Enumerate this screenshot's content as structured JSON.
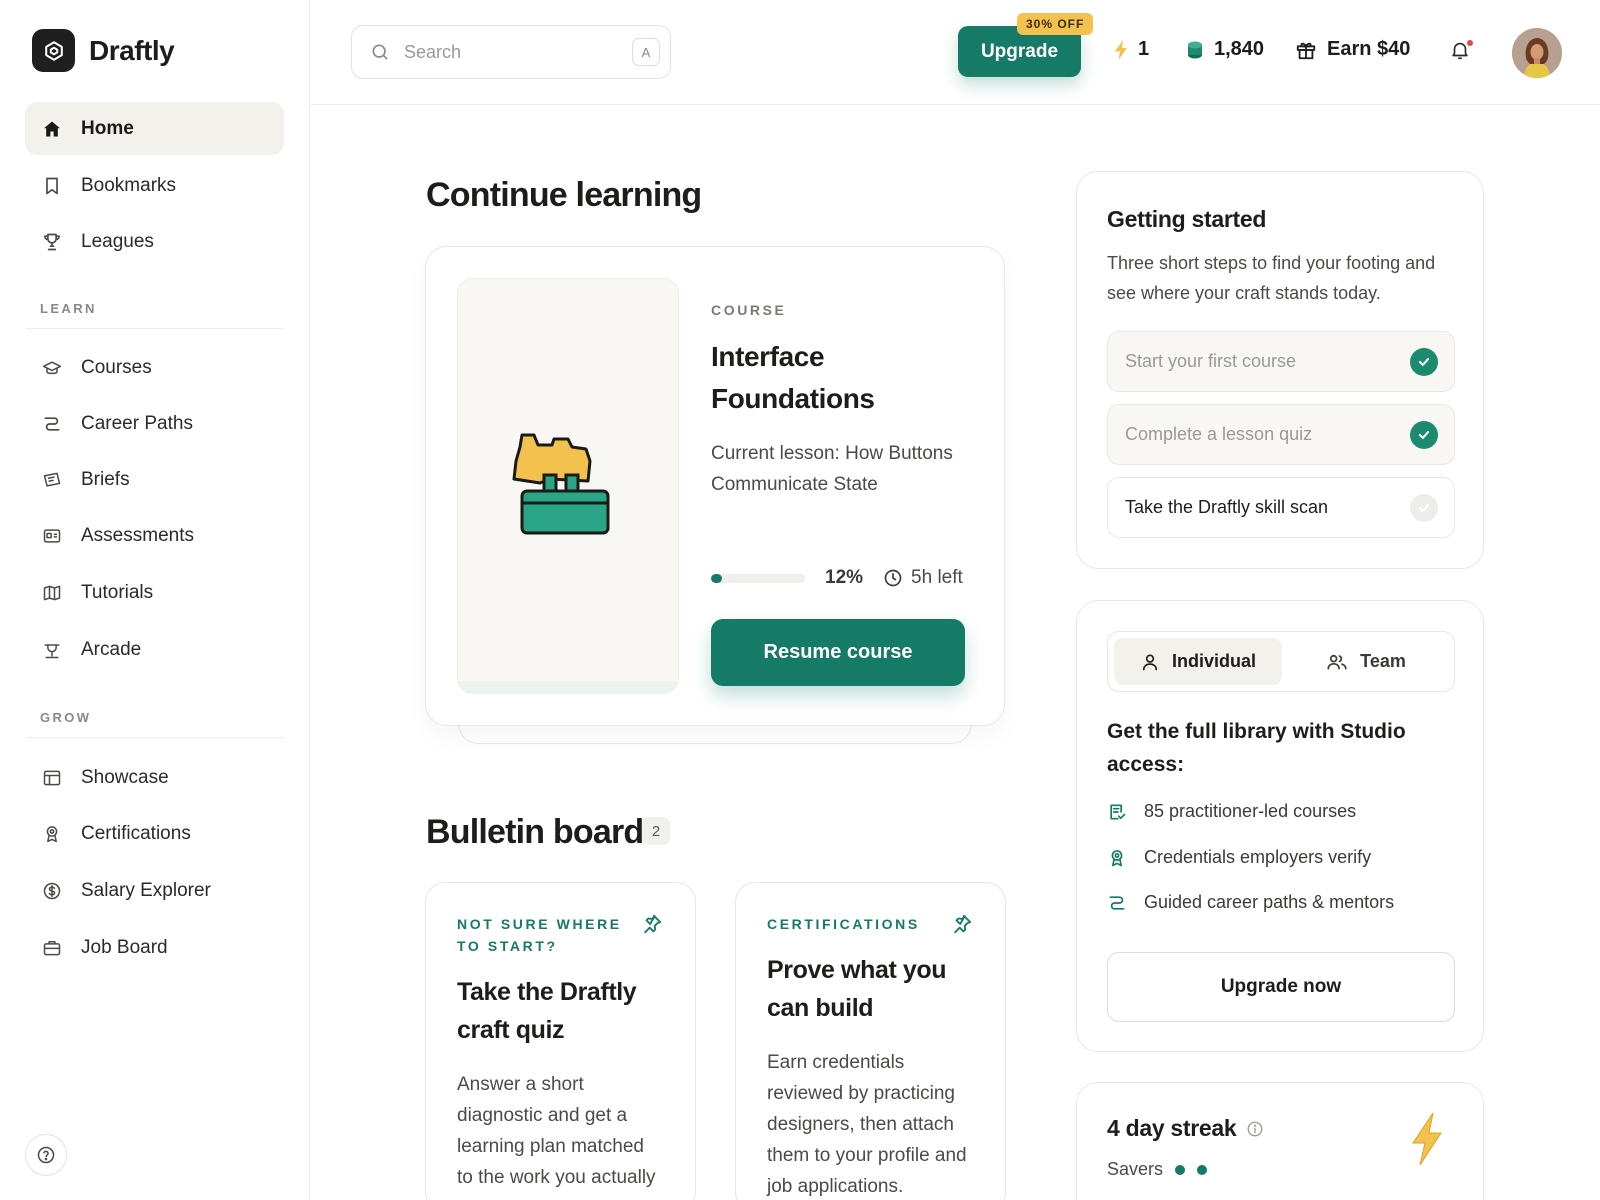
{
  "brand": {
    "name": "Draftly"
  },
  "sidebar": {
    "primary": [
      {
        "label": "Home",
        "icon": "home-icon",
        "active": true
      },
      {
        "label": "Bookmarks",
        "icon": "bookmark-icon"
      },
      {
        "label": "Leagues",
        "icon": "trophy-icon"
      }
    ],
    "learn_label": "LEARN",
    "learn": [
      {
        "label": "Courses",
        "icon": "graduation-cap-icon"
      },
      {
        "label": "Career Paths",
        "icon": "path-icon"
      },
      {
        "label": "Briefs",
        "icon": "brief-icon"
      },
      {
        "label": "Assessments",
        "icon": "id-card-icon"
      },
      {
        "label": "Tutorials",
        "icon": "map-icon"
      },
      {
        "label": "Arcade",
        "icon": "arcade-icon"
      }
    ],
    "grow_label": "GROW",
    "grow": [
      {
        "label": "Showcase",
        "icon": "layout-icon"
      },
      {
        "label": "Certifications",
        "icon": "award-icon"
      },
      {
        "label": "Salary Explorer",
        "icon": "dollar-icon"
      },
      {
        "label": "Job Board",
        "icon": "briefcase-icon"
      }
    ]
  },
  "header": {
    "search_placeholder": "Search",
    "search_shortcut": "A",
    "upgrade_label": "Upgrade",
    "discount_label": "30% OFF",
    "energy": "1",
    "coins": "1,840",
    "earn_label": "Earn $40"
  },
  "main": {
    "continue_title": "Continue learning",
    "course": {
      "eyebrow": "COURSE",
      "title": "Interface Foundations",
      "lesson": "Current lesson: How Buttons Communicate State",
      "progress": 0.12,
      "progress_label": "12%",
      "time_left": "5h left",
      "resume_label": "Resume course"
    },
    "bulletin_title": "Bulletin board",
    "bulletin_count": "2",
    "bulletin": [
      {
        "eyebrow": "NOT SURE WHERE TO START?",
        "title": "Take the Draftly craft quiz",
        "body": "Answer a short diagnostic and get a learning plan matched to the work you actually do day to day."
      },
      {
        "eyebrow": "CERTIFICATIONS",
        "title": "Prove what you can build",
        "body": "Earn credentials reviewed by practicing designers, then attach them to your profile and job applications."
      }
    ]
  },
  "getting_started": {
    "title": "Getting started",
    "subtitle": "Three short steps to find your footing and see where your craft stands today.",
    "steps": [
      {
        "label": "Start your first course",
        "done": true
      },
      {
        "label": "Complete a lesson quiz",
        "done": true
      },
      {
        "label": "Take the Draftly skill scan",
        "done": false
      }
    ]
  },
  "plans": {
    "tab_individual": "Individual",
    "tab_team": "Team",
    "title": "Get the full library with Studio access:",
    "features": [
      {
        "label": "85 practitioner-led courses",
        "icon": "course-list-icon"
      },
      {
        "label": "Credentials employers verify",
        "icon": "award-icon"
      },
      {
        "label": "Guided career paths & mentors",
        "icon": "path-icon"
      }
    ],
    "cta": "Upgrade now"
  },
  "streak": {
    "title": "4 day streak",
    "savers_label": "Savers",
    "savers_count": 2
  },
  "colors": {
    "accent": "#157a66",
    "highlight": "#f2c14e",
    "check": "#1b8a6e"
  }
}
